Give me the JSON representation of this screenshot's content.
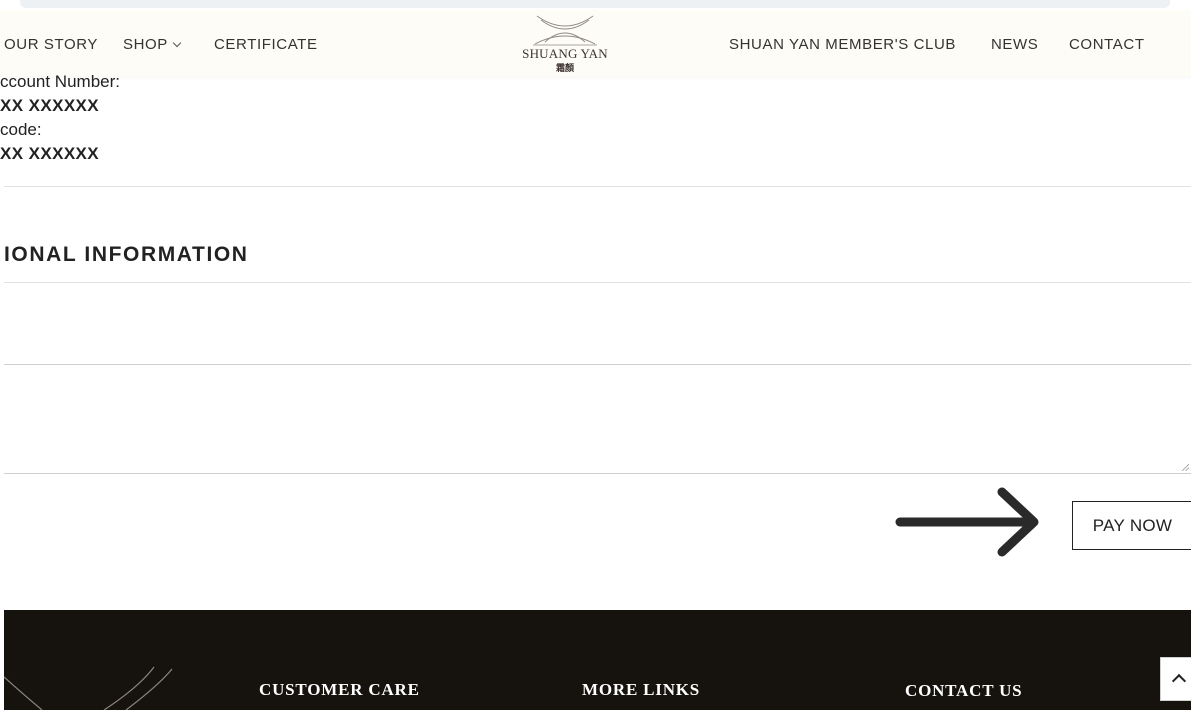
{
  "nav": {
    "our_story": "OUR STORY",
    "shop": "SHOP",
    "certificate": "CERTIFICATE",
    "members_club": "SHUAN YAN MEMBER'S CLUB",
    "news": "NEWS",
    "contact": "CONTACT"
  },
  "logo": {
    "name": "SHUANG YAN",
    "chinese": "霜顏"
  },
  "bank_details": {
    "account_label": "ccount Number:",
    "account_value": "XX XXXXXX",
    "code_label": "code:",
    "code_value": "XX XXXXXX"
  },
  "section": {
    "title": "IONAL INFORMATION"
  },
  "order_notes": {
    "value": ""
  },
  "pay_button": {
    "label": "PAY NOW"
  },
  "footer": {
    "customer_care": "CUSTOMER CARE",
    "more_links": "MORE LINKS",
    "contact_us": "CONTACT US"
  },
  "colors": {
    "header_bg": "#fdfcf6",
    "footer_bg": "#16120d",
    "text": "#222222",
    "logo_text": "#3e3433"
  },
  "icons": {
    "shop_dropdown": "chevron-down-icon",
    "annotation": "arrow-right-icon",
    "back_to_top": "chevron-up-icon"
  }
}
